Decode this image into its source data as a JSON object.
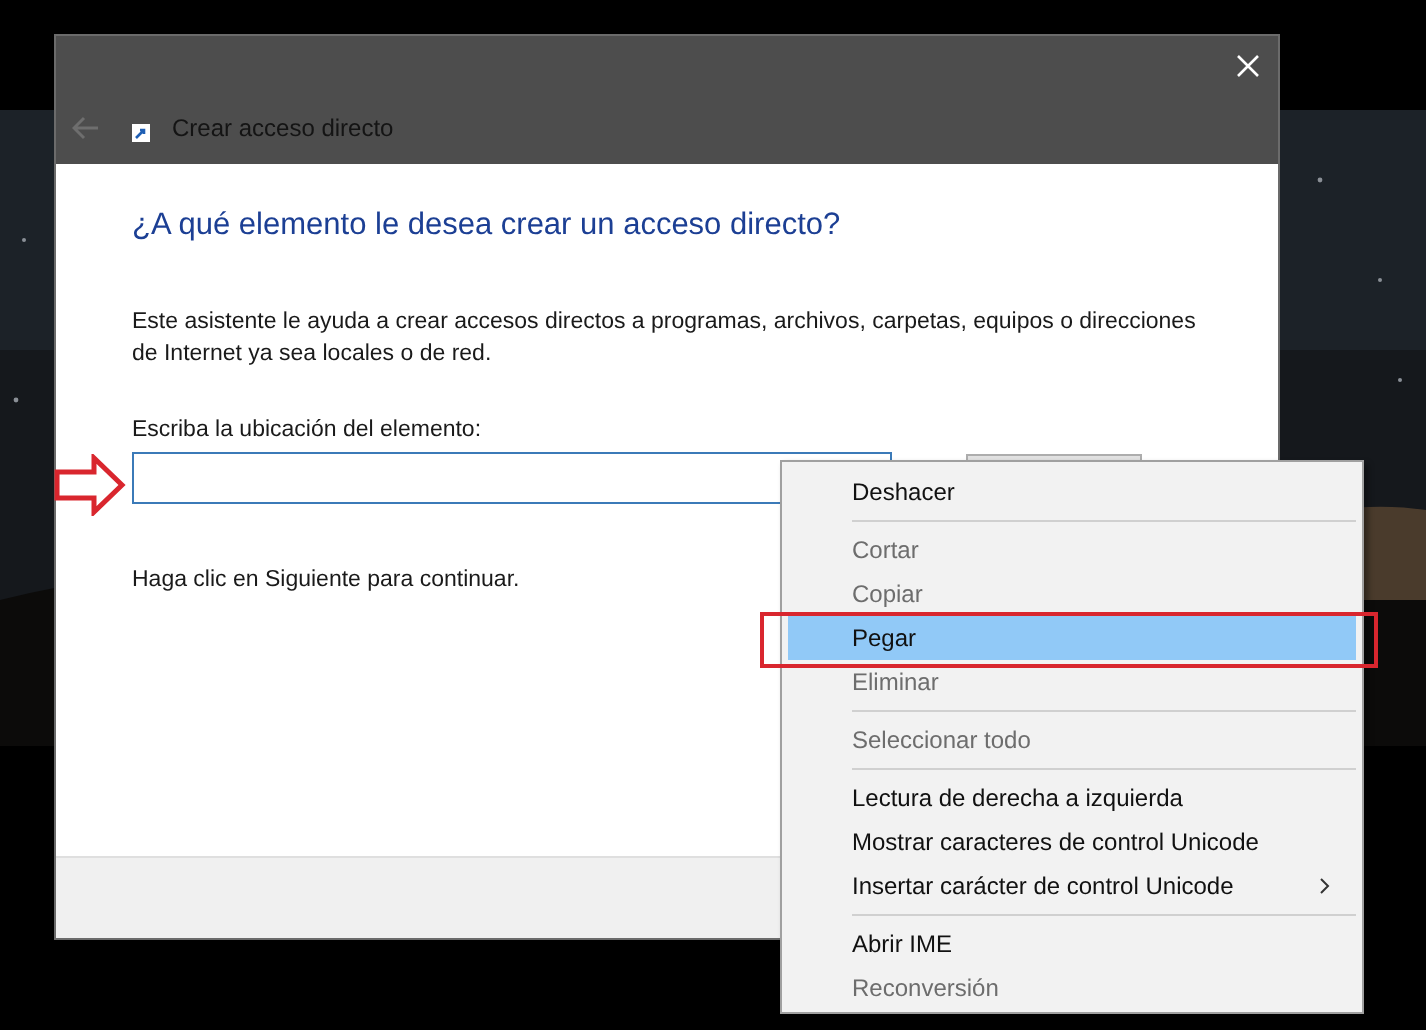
{
  "window": {
    "title": "Crear acceso directo",
    "back_disabled": true
  },
  "wizard": {
    "heading": "¿A qué elemento le desea crear un acceso directo?",
    "description": "Este asistente le ayuda a crear accesos directos a programas, archivos, carpetas, equipos o direcciones de Internet ya sea locales o de red.",
    "location_label": "Escriba la ubicación del elemento:",
    "hint": "Haga clic en Siguiente para continuar."
  },
  "context_menu": [
    {
      "kind": "item",
      "label": "Deshacer",
      "disabled": false,
      "selected": false
    },
    {
      "kind": "separator"
    },
    {
      "kind": "item",
      "label": "Cortar",
      "disabled": true,
      "selected": false
    },
    {
      "kind": "item",
      "label": "Copiar",
      "disabled": true,
      "selected": false
    },
    {
      "kind": "item",
      "label": "Pegar",
      "disabled": false,
      "selected": true
    },
    {
      "kind": "item",
      "label": "Eliminar",
      "disabled": true,
      "selected": false
    },
    {
      "kind": "separator"
    },
    {
      "kind": "item",
      "label": "Seleccionar todo",
      "disabled": true,
      "selected": false
    },
    {
      "kind": "separator"
    },
    {
      "kind": "item",
      "label": "Lectura de derecha a izquierda",
      "disabled": false,
      "selected": false
    },
    {
      "kind": "item",
      "label": "Mostrar caracteres de control Unicode",
      "disabled": false,
      "selected": false
    },
    {
      "kind": "submenu",
      "label": "Insertar carácter de control Unicode",
      "disabled": false,
      "selected": false
    },
    {
      "kind": "separator"
    },
    {
      "kind": "item",
      "label": "Abrir IME",
      "disabled": false,
      "selected": false
    },
    {
      "kind": "item",
      "label": "Reconversión",
      "disabled": true,
      "selected": false
    }
  ]
}
